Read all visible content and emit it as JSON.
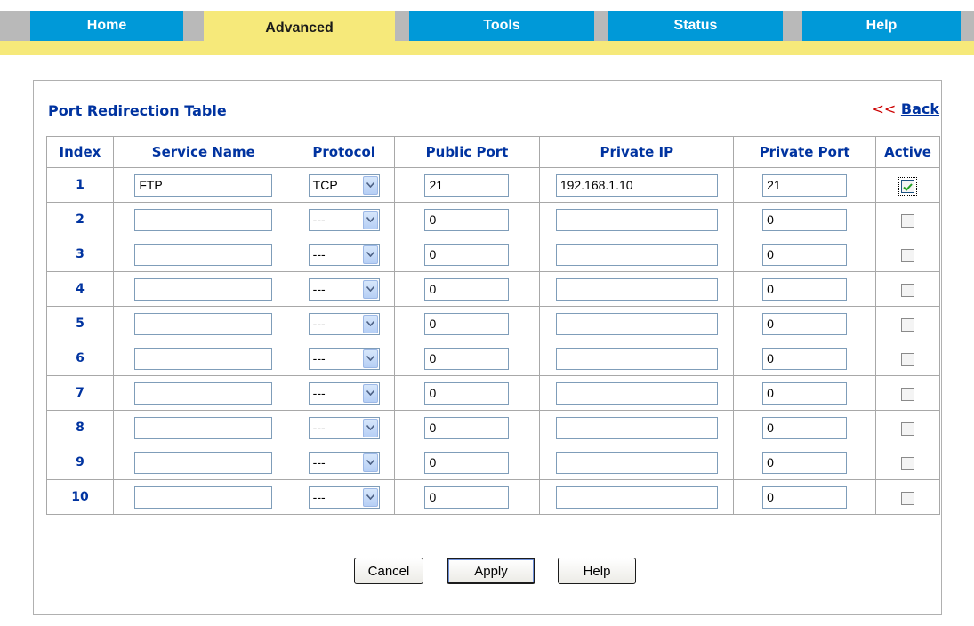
{
  "nav": {
    "tabs": [
      {
        "label": "Home"
      },
      {
        "label": "Advanced",
        "active": true
      },
      {
        "label": "Tools"
      },
      {
        "label": "Status"
      },
      {
        "label": "Help"
      }
    ]
  },
  "page": {
    "title": "Port Redirection Table",
    "back_arrows": "<<",
    "back_label": "Back"
  },
  "table": {
    "headers": [
      "Index",
      "Service Name",
      "Protocol",
      "Public Port",
      "Private IP",
      "Private Port",
      "Active"
    ],
    "rows": [
      {
        "index": "1",
        "service_name": "FTP",
        "protocol": "TCP",
        "public_port": "21",
        "private_ip": "192.168.1.10",
        "private_port": "21",
        "active": true
      },
      {
        "index": "2",
        "service_name": "",
        "protocol": "---",
        "public_port": "0",
        "private_ip": "",
        "private_port": "0",
        "active": false
      },
      {
        "index": "3",
        "service_name": "",
        "protocol": "---",
        "public_port": "0",
        "private_ip": "",
        "private_port": "0",
        "active": false
      },
      {
        "index": "4",
        "service_name": "",
        "protocol": "---",
        "public_port": "0",
        "private_ip": "",
        "private_port": "0",
        "active": false
      },
      {
        "index": "5",
        "service_name": "",
        "protocol": "---",
        "public_port": "0",
        "private_ip": "",
        "private_port": "0",
        "active": false
      },
      {
        "index": "6",
        "service_name": "",
        "protocol": "---",
        "public_port": "0",
        "private_ip": "",
        "private_port": "0",
        "active": false
      },
      {
        "index": "7",
        "service_name": "",
        "protocol": "---",
        "public_port": "0",
        "private_ip": "",
        "private_port": "0",
        "active": false
      },
      {
        "index": "8",
        "service_name": "",
        "protocol": "---",
        "public_port": "0",
        "private_ip": "",
        "private_port": "0",
        "active": false
      },
      {
        "index": "9",
        "service_name": "",
        "protocol": "---",
        "public_port": "0",
        "private_ip": "",
        "private_port": "0",
        "active": false
      },
      {
        "index": "10",
        "service_name": "",
        "protocol": "---",
        "public_port": "0",
        "private_ip": "",
        "private_port": "0",
        "active": false
      }
    ]
  },
  "buttons": {
    "cancel": "Cancel",
    "apply": "Apply",
    "help": "Help"
  },
  "colors": {
    "tab_blue": "#0099d8",
    "tab_active_yellow": "#f6e97a",
    "heading_blue": "#0033a0",
    "back_arrows_red": "#cc0000"
  }
}
